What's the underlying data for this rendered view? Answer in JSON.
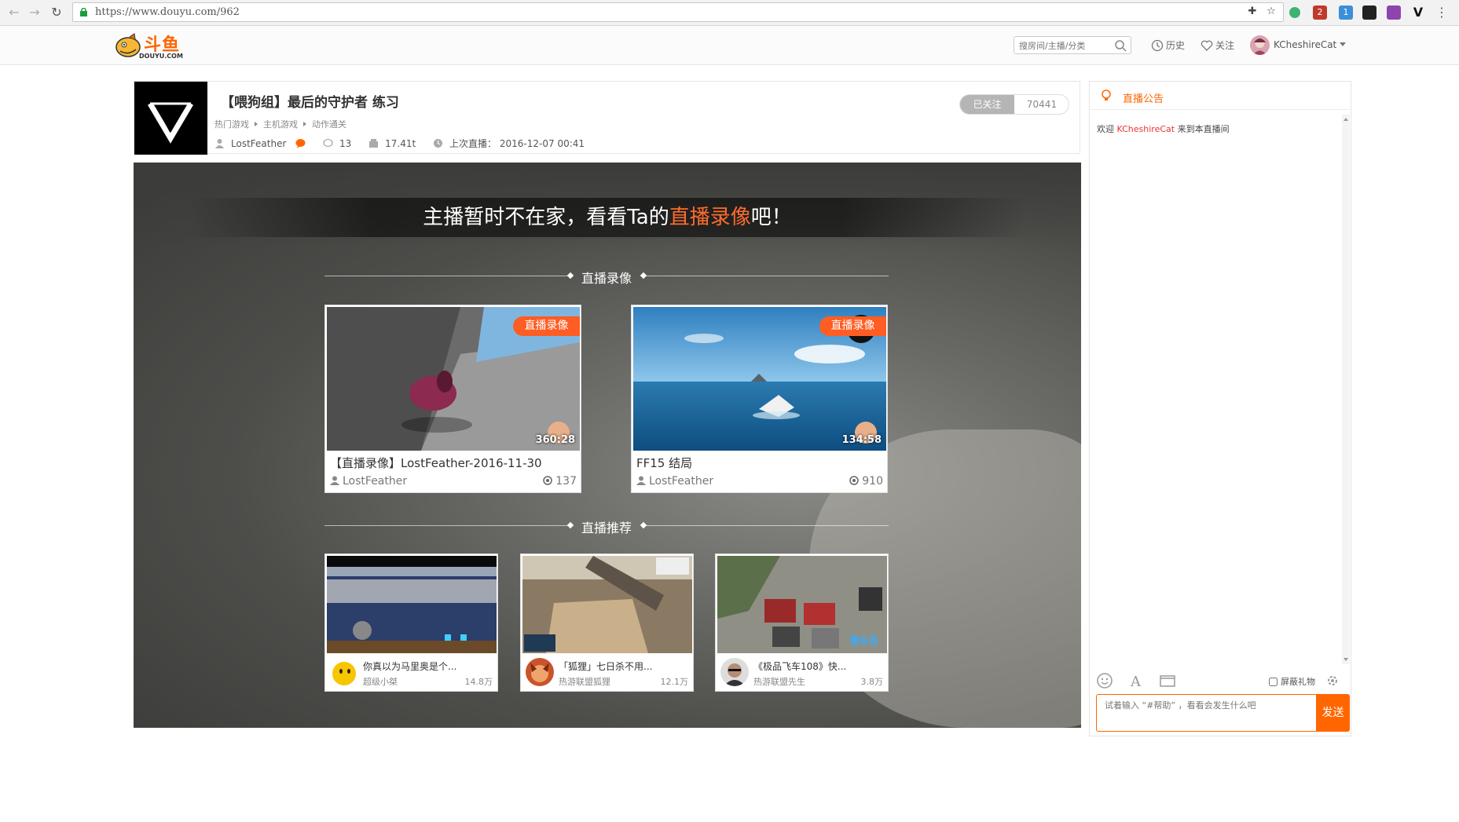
{
  "browser": {
    "url": "https://www.douyu.com/962",
    "extension_badges": [
      "2",
      "1"
    ]
  },
  "header": {
    "logo_cn": "斗鱼",
    "logo_en": "DOUYU.COM",
    "search_placeholder": "搜房间/主播/分类",
    "history_label": "历史",
    "follow_label": "关注",
    "username": "KCheshireCat"
  },
  "room": {
    "title": "【喂狗组】最后的守护者 练习",
    "breadcrumbs": [
      "热门游戏",
      "主机游戏",
      "动作通关"
    ],
    "anchor": "LostFeather",
    "comments": "13",
    "weight": "17.41t",
    "last_live_label": "上次直播：",
    "last_live_time": "2016-12-07 00:41",
    "followed_label": "已关注",
    "follower_count": "70441"
  },
  "player": {
    "banner_prefix": "主播暂时不在家，看看Ta的",
    "banner_highlight": "直播录像",
    "banner_suffix": "吧！",
    "replay_section_title": "直播录像",
    "recommend_section_title": "直播推荐",
    "replays": [
      {
        "tag": "直播录像",
        "duration": "360:28",
        "title": "【直播录像】LostFeather-2016-11-30",
        "author": "LostFeather",
        "views": "137"
      },
      {
        "tag": "直播录像",
        "duration": "134:58",
        "title": "FF15 结局",
        "author": "LostFeather",
        "views": "910"
      }
    ],
    "recommendations": [
      {
        "title": "你真以为马里奥是个...",
        "anchor": "超级小桀",
        "count": "14.8万"
      },
      {
        "title": "「狐狸」七日杀不用...",
        "anchor": "热游联盟狐狸",
        "count": "12.1万"
      },
      {
        "title": "《极品飞车108》快...",
        "anchor": "热游联盟先生",
        "count": "3.8万"
      }
    ],
    "rec3_overlay_text": "第6名"
  },
  "chat": {
    "header": "直播公告",
    "welcome_prefix": "欢迎",
    "welcome_nick": "KCheshireCat",
    "welcome_suffix": "来到本直播间",
    "shield_gifts_label": "屏蔽礼物",
    "input_placeholder": "试着输入 “#帮助” ，看看会发生什么吧",
    "send_label": "发送"
  },
  "colors": {
    "brand_orange": "#ff6600",
    "tag_orange": "#ff5d23",
    "nick_red": "#ee3333"
  }
}
